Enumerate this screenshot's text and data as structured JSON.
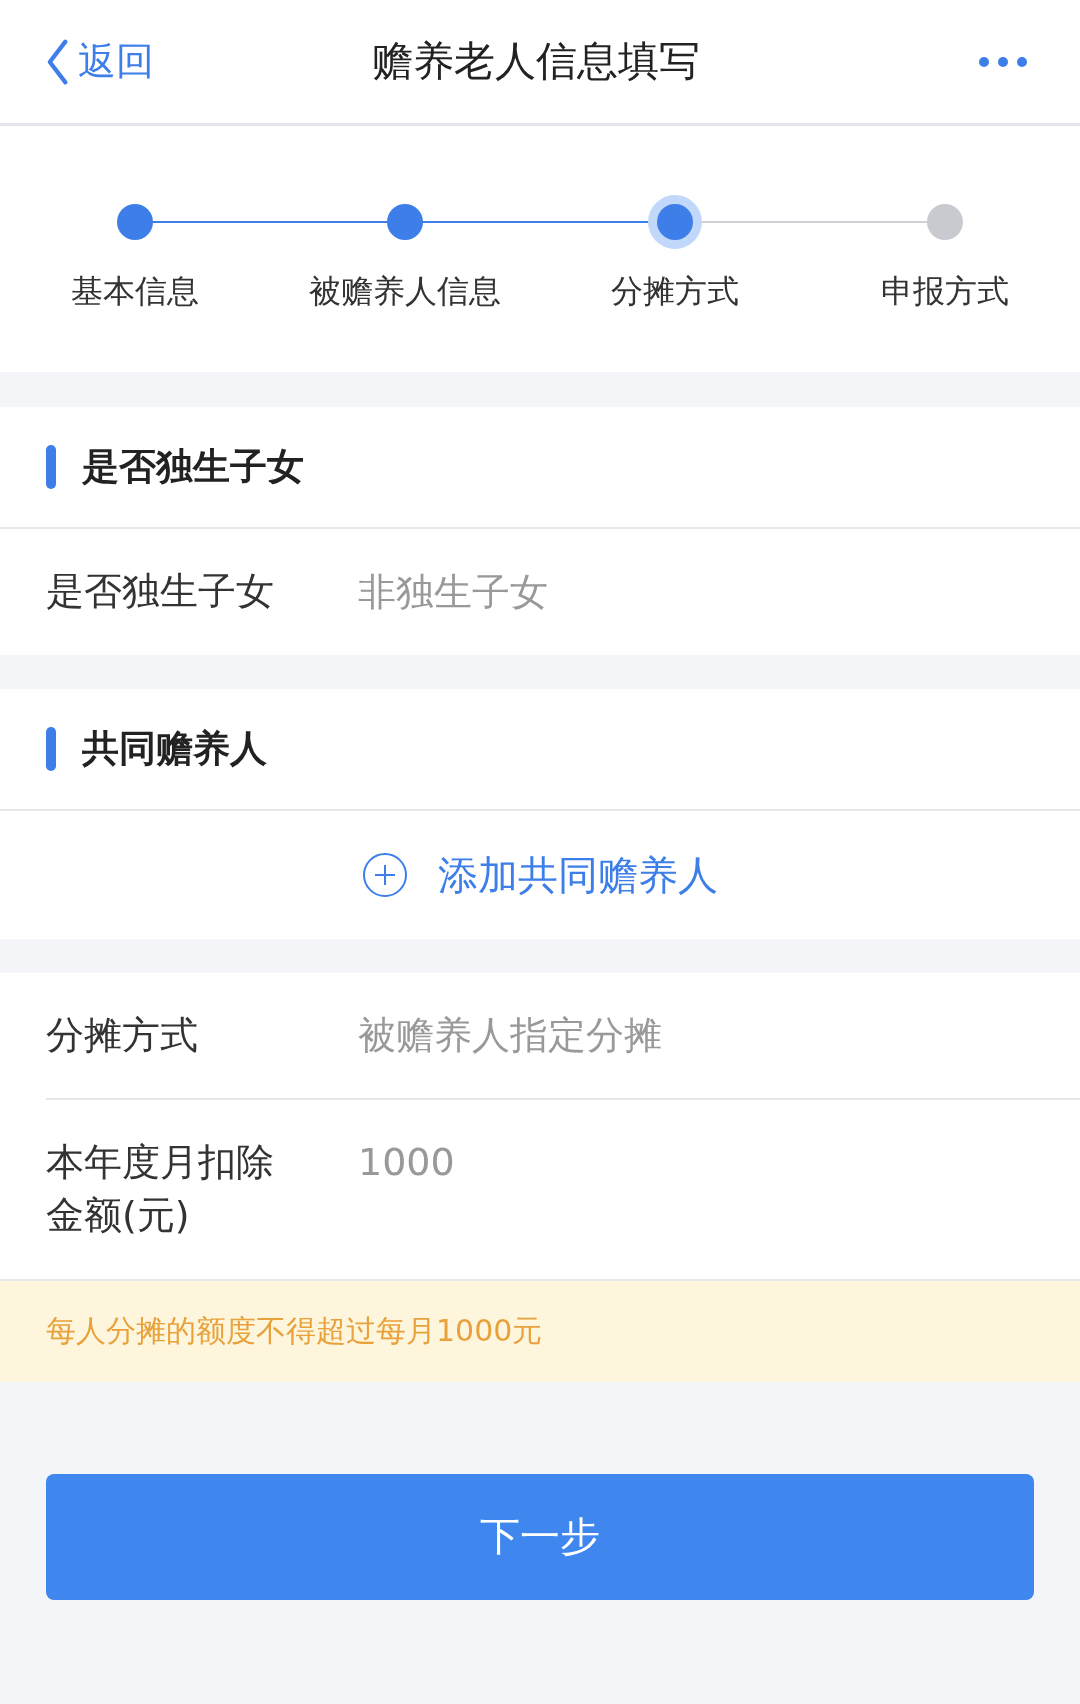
{
  "header": {
    "back": "返回",
    "title": "赡养老人信息填写"
  },
  "steps": [
    {
      "label": "基本信息",
      "reached": true,
      "selected": false
    },
    {
      "label": "被赡养人信息",
      "reached": true,
      "selected": false
    },
    {
      "label": "分摊方式",
      "reached": true,
      "selected": true
    },
    {
      "label": "申报方式",
      "reached": false,
      "selected": false
    }
  ],
  "only_child": {
    "title": "是否独生子女",
    "field": {
      "label": "是否独生子女",
      "value": "非独生子女"
    }
  },
  "co_supporters": {
    "title": "共同赡养人",
    "add": "添加共同赡养人"
  },
  "fields": [
    {
      "label": "分摊方式",
      "value": "被赡养人指定分摊"
    },
    {
      "label": "本年度月扣除金额(元)",
      "value": "1000"
    }
  ],
  "notice": "每人分摊的额度不得超过每月1000元",
  "next_button": "下一步"
}
